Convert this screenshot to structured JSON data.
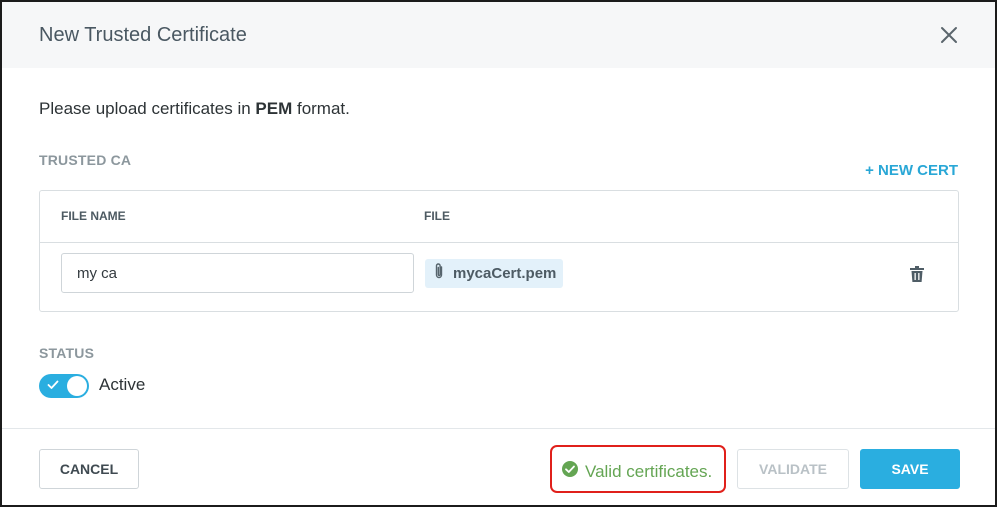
{
  "dialog": {
    "title": "New Trusted Certificate",
    "close_icon": "close-icon"
  },
  "instruction": {
    "prefix": "Please upload certificates in ",
    "emphasis": "PEM",
    "suffix": " format."
  },
  "trusted_ca": {
    "section_label": "TRUSTED CA",
    "new_cert_label": "+ NEW CERT",
    "columns": {
      "file_name": "FILE NAME",
      "file": "FILE"
    },
    "rows": [
      {
        "file_name": "my ca",
        "file": "mycaCert.pem",
        "file_icon": "paperclip-icon",
        "delete_icon": "trash-icon"
      }
    ]
  },
  "status": {
    "section_label": "STATUS",
    "toggle_on": true,
    "toggle_label": "Active"
  },
  "footer": {
    "cancel_label": "CANCEL",
    "validation_message": "Valid certificates.",
    "validation_icon": "check-circle-icon",
    "validate_label": "VALIDATE",
    "save_label": "SAVE"
  },
  "colors": {
    "accent": "#2aaee0",
    "success": "#64a553",
    "highlight": "#e0201b"
  }
}
